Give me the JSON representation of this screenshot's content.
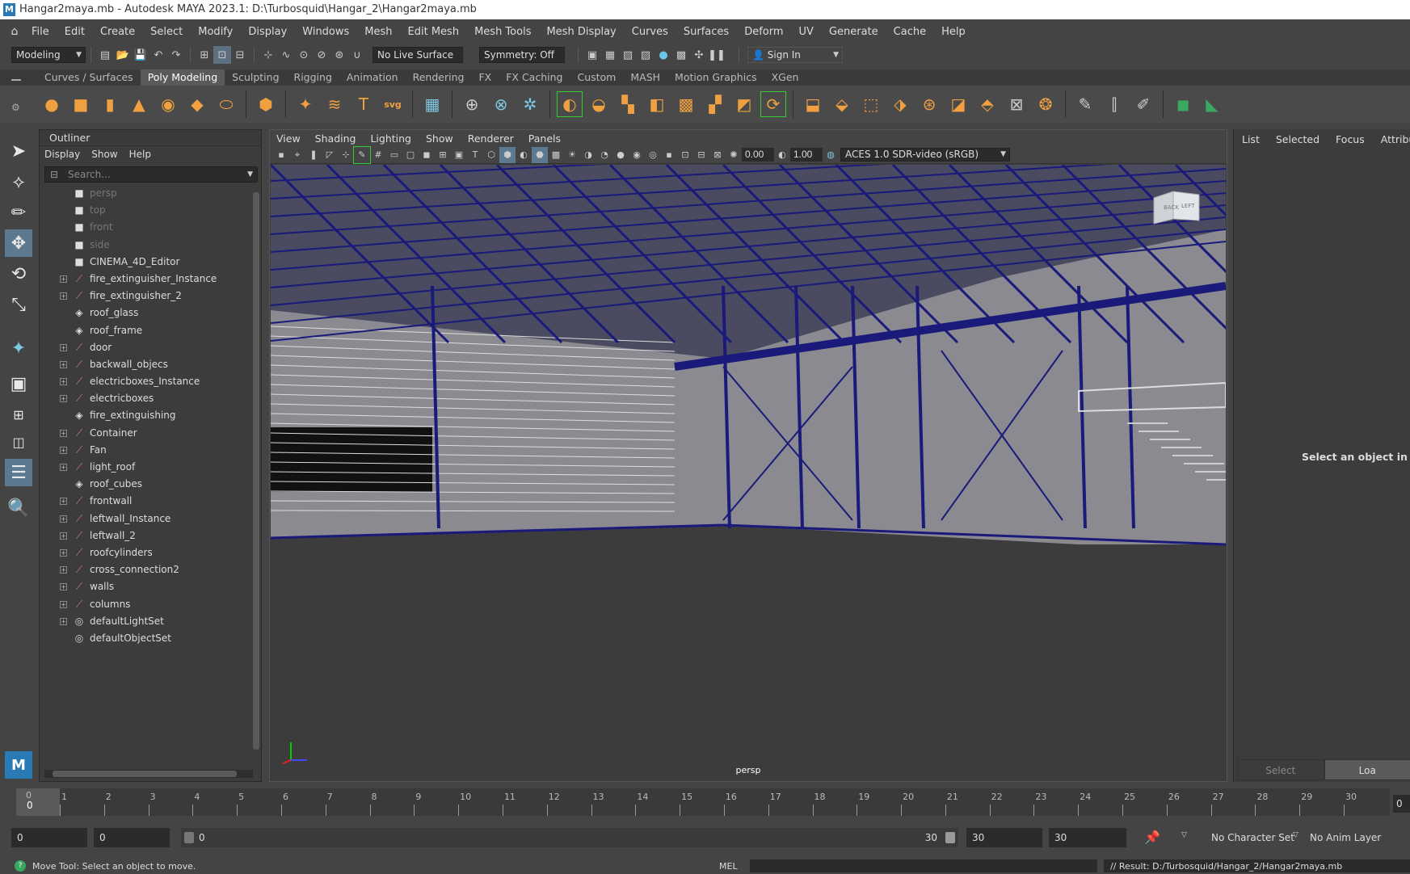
{
  "window": {
    "title": "Hangar2maya.mb - Autodesk MAYA 2023.1: D:\\Turbosquid\\Hangar_2\\Hangar2maya.mb"
  },
  "menubar": [
    "File",
    "Edit",
    "Create",
    "Select",
    "Modify",
    "Display",
    "Windows",
    "Mesh",
    "Edit Mesh",
    "Mesh Tools",
    "Mesh Display",
    "Curves",
    "Surfaces",
    "Deform",
    "UV",
    "Generate",
    "Cache",
    "Help"
  ],
  "statusline": {
    "menuset": "Modeling",
    "live_surface": "No Live Surface",
    "symmetry": "Symmetry: Off",
    "sign_in": "Sign In"
  },
  "shelf_tabs": [
    "Curves / Surfaces",
    "Poly Modeling",
    "Sculpting",
    "Rigging",
    "Animation",
    "Rendering",
    "FX",
    "FX Caching",
    "Custom",
    "MASH",
    "Motion Graphics",
    "XGen"
  ],
  "shelf_active": "Poly Modeling",
  "outliner": {
    "title": "Outliner",
    "menu": [
      "Display",
      "Show",
      "Help"
    ],
    "search_placeholder": "Search...",
    "items": [
      {
        "label": "persp",
        "icon": "camera-icon",
        "exp": false,
        "dim": true
      },
      {
        "label": "top",
        "icon": "camera-icon",
        "exp": false,
        "dim": true
      },
      {
        "label": "front",
        "icon": "camera-icon",
        "exp": false,
        "dim": true
      },
      {
        "label": "side",
        "icon": "camera-icon",
        "exp": false,
        "dim": true
      },
      {
        "label": "CINEMA_4D_Editor",
        "icon": "camera-icon",
        "exp": false,
        "dim": false
      },
      {
        "label": "fire_extinguisher_Instance",
        "icon": "transform-group-icon",
        "exp": true,
        "dim": false
      },
      {
        "label": "fire_extinguisher_2",
        "icon": "transform-group-icon",
        "exp": true,
        "dim": false
      },
      {
        "label": "roof_glass",
        "icon": "mesh-icon",
        "exp": false,
        "dim": false
      },
      {
        "label": "roof_frame",
        "icon": "mesh-icon",
        "exp": false,
        "dim": false
      },
      {
        "label": "door",
        "icon": "transform-group-icon",
        "exp": true,
        "dim": false
      },
      {
        "label": "backwall_objecs",
        "icon": "transform-group-icon",
        "exp": true,
        "dim": false
      },
      {
        "label": "electricboxes_Instance",
        "icon": "transform-group-icon",
        "exp": true,
        "dim": false
      },
      {
        "label": "electricboxes",
        "icon": "transform-group-icon",
        "exp": true,
        "dim": false
      },
      {
        "label": "fire_extinguishing",
        "icon": "mesh-icon",
        "exp": false,
        "dim": false
      },
      {
        "label": "Container",
        "icon": "transform-group-icon",
        "exp": true,
        "dim": false
      },
      {
        "label": "Fan",
        "icon": "transform-group-icon",
        "exp": true,
        "dim": false
      },
      {
        "label": "light_roof",
        "icon": "transform-group-icon",
        "exp": true,
        "dim": false
      },
      {
        "label": "roof_cubes",
        "icon": "mesh-icon",
        "exp": false,
        "dim": false
      },
      {
        "label": "frontwall",
        "icon": "transform-group-icon",
        "exp": true,
        "dim": false
      },
      {
        "label": "leftwall_Instance",
        "icon": "transform-group-icon",
        "exp": true,
        "dim": false
      },
      {
        "label": "leftwall_2",
        "icon": "transform-group-icon",
        "exp": true,
        "dim": false
      },
      {
        "label": "roofcylinders",
        "icon": "transform-group-icon",
        "exp": true,
        "dim": false
      },
      {
        "label": "cross_connection2",
        "icon": "transform-group-icon",
        "exp": true,
        "dim": false
      },
      {
        "label": "walls",
        "icon": "transform-group-icon",
        "exp": true,
        "dim": false
      },
      {
        "label": "columns",
        "icon": "transform-group-icon",
        "exp": true,
        "dim": false
      },
      {
        "label": "defaultLightSet",
        "icon": "set-icon",
        "exp": true,
        "dim": false
      },
      {
        "label": "defaultObjectSet",
        "icon": "set-icon",
        "exp": false,
        "dim": false
      }
    ]
  },
  "viewport": {
    "menu": [
      "View",
      "Shading",
      "Lighting",
      "Show",
      "Renderer",
      "Panels"
    ],
    "exposure": "0.00",
    "gamma": "1.00",
    "color_space": "ACES 1.0 SDR-video (sRGB)",
    "camera": "persp",
    "viewcube_back": "BACK",
    "viewcube_left": "LEFT"
  },
  "attribute_editor": {
    "tabs": [
      "List",
      "Selected",
      "Focus",
      "Attributes"
    ],
    "message": "Select an object in the sc",
    "select_btn": "Select",
    "load_btn": "Loa"
  },
  "time_slider": {
    "current": "0",
    "ticks": [
      "1",
      "2",
      "3",
      "4",
      "5",
      "6",
      "7",
      "8",
      "9",
      "10",
      "11",
      "12",
      "13",
      "14",
      "15",
      "16",
      "17",
      "18",
      "19",
      "20",
      "21",
      "22",
      "23",
      "24",
      "25",
      "26",
      "27",
      "28",
      "29",
      "30"
    ],
    "end_field": "0"
  },
  "range_slider": {
    "start": "0",
    "anim_start": "0",
    "range_left": "0",
    "range_right": "30",
    "anim_end": "30",
    "end": "30",
    "character_set": "No Character Set",
    "anim_layer": "No Anim Layer"
  },
  "command_line": {
    "help": "Move Tool: Select an object to move.",
    "lang": "MEL",
    "result": "// Result: D:/Turbosquid/Hangar_2/Hangar2maya.mb"
  }
}
